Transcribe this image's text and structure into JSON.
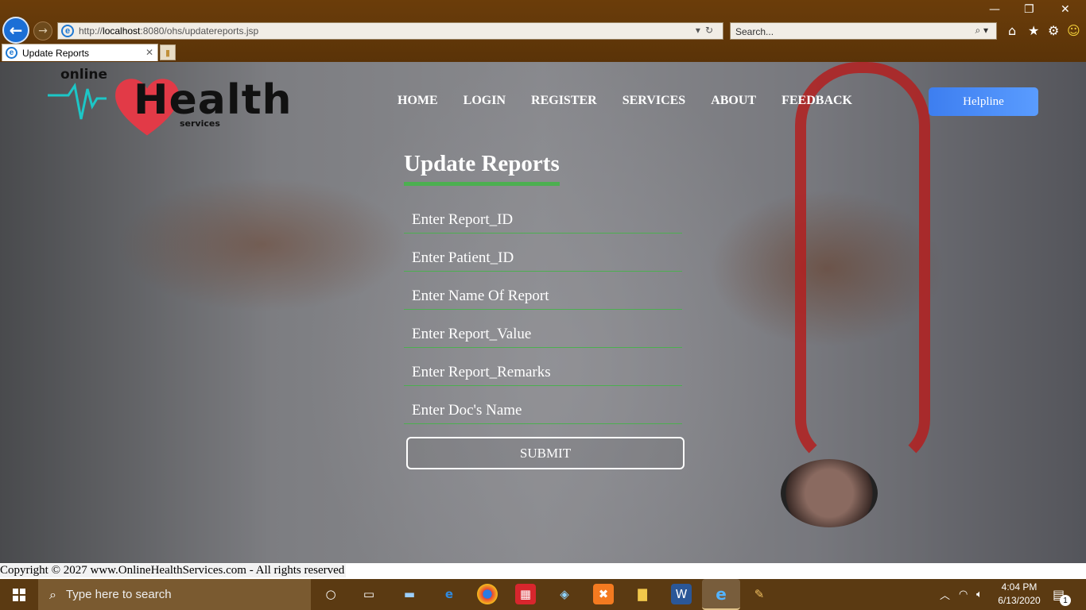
{
  "browser": {
    "url_prefix": "http://",
    "url_host": "localhost",
    "url_rest": ":8080/ohs/updatereports.jsp",
    "search_placeholder": "Search...",
    "tab_title": "Update Reports"
  },
  "logo": {
    "online": "online",
    "word": "Health",
    "services": "services"
  },
  "nav": {
    "home": "HOME",
    "login": "LOGIN",
    "register": "REGISTER",
    "services": "SERVICES",
    "about": "ABOUT",
    "feedback": "FEEDBACK",
    "helpline": "Helpline"
  },
  "form": {
    "title": "Update Reports",
    "fields": {
      "report_id": "Enter Report_ID",
      "patient_id": "Enter Patient_ID",
      "report_name": "Enter Name Of Report",
      "report_value": "Enter Report_Value",
      "report_remarks": "Enter Report_Remarks",
      "doc_name": "Enter Doc's Name"
    },
    "submit": "SUBMIT"
  },
  "footer": {
    "text": "Copyright © 2027 www.OnlineHealthServices.com - All rights reserved"
  },
  "taskbar": {
    "search_placeholder": "Type here to search",
    "time": "4:04 PM",
    "date": "6/13/2020",
    "notification_count": "1"
  },
  "colors": {
    "accent_green": "#4caf50",
    "helpline_blue": "#3d7ef0",
    "chrome_brown": "#6b3d0a"
  }
}
